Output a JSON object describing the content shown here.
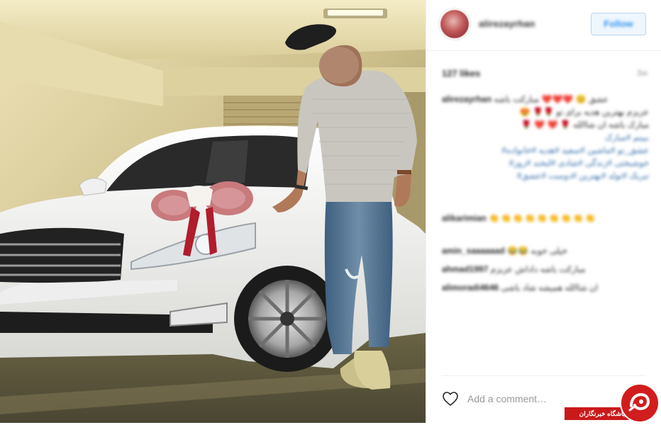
{
  "post": {
    "username": "alirezayrhan",
    "follow_label": "Follow",
    "likes": "127 likes",
    "time_ago": "3w"
  },
  "comments": [
    {
      "user": "alirezayrhan",
      "text": "عشق 😊 ❤️❤️❤️ مبارکت باشه"
    },
    {
      "user": "",
      "text": "😍 🌹🌹 عزیزم بهترین هدیه برای تو"
    },
    {
      "user": "",
      "text": "🌹 ❤️ ❤️ 🌹 مبارک باشه ان شاالله"
    },
    {
      "user": "",
      "text": "ببینم #مبارک"
    },
    {
      "user": "",
      "text": "#عشق_تو #ماشین #سفید #هدیه #خانواده"
    },
    {
      "user": "",
      "text": "#خوشبختی #زندگی #شادی #لبخند #روز"
    },
    {
      "user": "",
      "text": "#تبریک #تولد #بهترین #دوست #عشق"
    },
    {
      "user": "alikarimian",
      "text": "👏👏👏👏👏👏👏👏👏"
    },
    {
      "user": "amin_saaaaaad",
      "text": "😂😂 خیلی خوبه"
    },
    {
      "user": "ahmad1997",
      "text": "مبارکت باشه داداش عزیزم"
    },
    {
      "user": "alimoradi4646",
      "text": "ان شاالله همیشه شاد باشی"
    }
  ],
  "add_comment_placeholder": "Add a comment…",
  "watermark": {
    "text": "باشگاه خبرنگاران"
  },
  "colors": {
    "follow_blue": "#3897f0",
    "watermark_red": "#c91a1a"
  },
  "icons": {
    "like": "heart-outline-icon",
    "watermark": "ybn-logo-icon"
  }
}
